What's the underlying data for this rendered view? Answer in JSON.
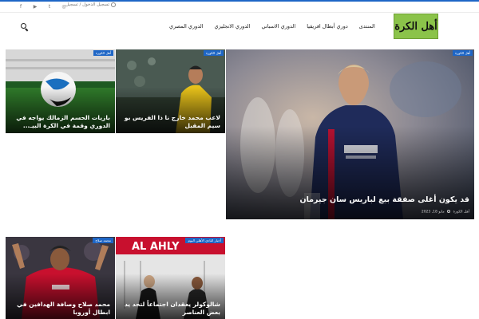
{
  "topbar": {
    "login_text": "تسجيل الدخول / تسجيل",
    "social": [
      {
        "name": "facebook-icon",
        "glyph": "f"
      },
      {
        "name": "youtube-icon",
        "glyph": "▶"
      },
      {
        "name": "twitter-icon",
        "glyph": "t"
      },
      {
        "name": "instagram-icon",
        "glyph": "◎"
      }
    ]
  },
  "header": {
    "logo_text": "أهل الكرة",
    "nav": [
      "الدوري المصري",
      "الدوري الانجليزي",
      "الدوري الاسباني",
      "دوري أبطال افريقيا",
      "المنتدى"
    ]
  },
  "colors": {
    "accent": "#1e66c6",
    "logo_bg": "#8bc34a"
  },
  "featured": {
    "badge": "أهل الكورة",
    "title": "قد يكون أغلى صفقة بيع لباريس سان جيرمان",
    "author": "أهل الكورة",
    "date": "مايو 18, 2023"
  },
  "cards": [
    {
      "badge": "أهل الكورة",
      "title": "لاعب محمد خارج نا ذا الفريس بو سيم المقبل"
    },
    {
      "badge": "أهل الكورة",
      "title": "بازيات الحسم الزمالك يواجه في الدوري وقمة في الكرة البيـ..."
    },
    {
      "badge": "أخبار النادي الأهلي اليوم",
      "title": "شالوكولر يعقدان اجتماعاً لتحد يد بعض العناصر"
    },
    {
      "badge": "محمد صلاح",
      "title": "محمد صلاح وصافة الهدافين في ابطال أوروبا"
    }
  ]
}
